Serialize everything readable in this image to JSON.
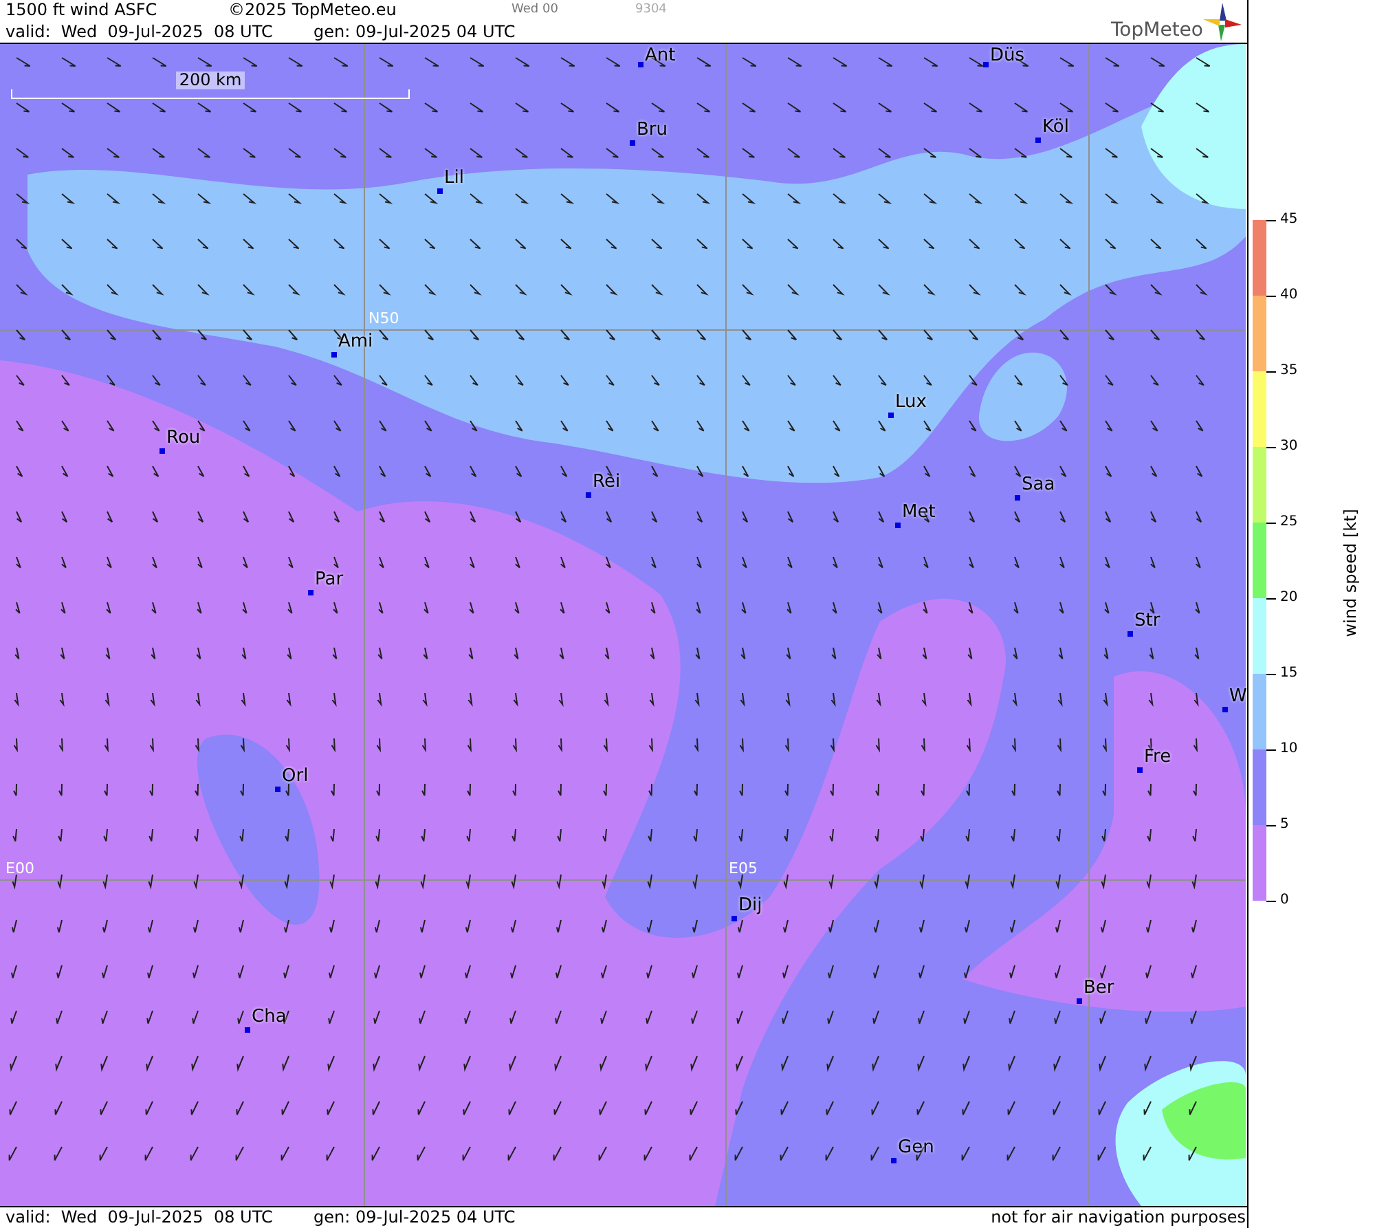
{
  "header": {
    "title": "1500 ft wind ASFC",
    "copyright": "©2025 TopMeteo.eu",
    "run": "Wed 00",
    "code": "9304",
    "valid": "valid:  Wed  09-Jul-2025  08 UTC",
    "generated": "gen: 09-Jul-2025 04 UTC"
  },
  "logo": {
    "text": "TopMeteo"
  },
  "map": {
    "scale": "200 km",
    "grid_labels": [
      "N50",
      "E00",
      "E05"
    ],
    "cities": [
      {
        "name": "Ant"
      },
      {
        "name": "Düs"
      },
      {
        "name": "Bru"
      },
      {
        "name": "Köl"
      },
      {
        "name": "Lil"
      },
      {
        "name": "Ami"
      },
      {
        "name": "Rou"
      },
      {
        "name": "Lux"
      },
      {
        "name": "Rei"
      },
      {
        "name": "Saa"
      },
      {
        "name": "Met"
      },
      {
        "name": "Par"
      },
      {
        "name": "Str"
      },
      {
        "name": "W"
      },
      {
        "name": "Fre"
      },
      {
        "name": "Orl"
      },
      {
        "name": "Dij"
      },
      {
        "name": "Ber"
      },
      {
        "name": "Cha"
      },
      {
        "name": "Gen"
      }
    ]
  },
  "legend": {
    "title": "wind speed [kt]",
    "bands": [
      {
        "color": "#f08068"
      },
      {
        "color": "#fcb468"
      },
      {
        "color": "#fcfc68"
      },
      {
        "color": "#c0fc68"
      },
      {
        "color": "#78f868"
      },
      {
        "color": "#b0fcfc"
      },
      {
        "color": "#94c4fc"
      },
      {
        "color": "#8c84f8"
      },
      {
        "color": "#c080f8"
      }
    ],
    "ticks": [
      "45",
      "40",
      "35",
      "30",
      "25",
      "20",
      "15",
      "10",
      "5",
      "0"
    ]
  },
  "footer": {
    "valid": "valid:  Wed  09-Jul-2025  08 UTC",
    "generated": "gen: 09-Jul-2025 04 UTC",
    "note": "not for air navigation purposes"
  }
}
